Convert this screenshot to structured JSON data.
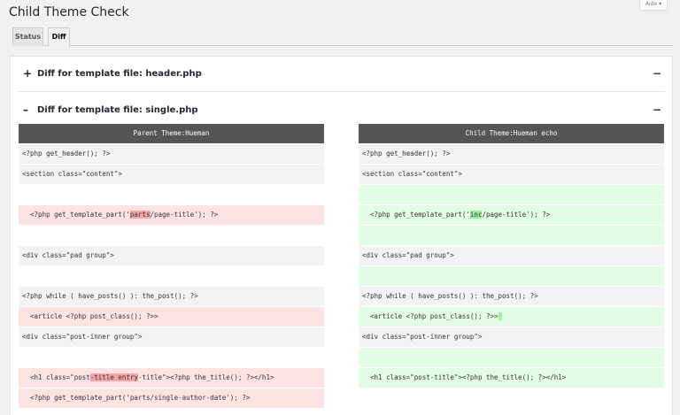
{
  "page": {
    "title": "Child Theme Check",
    "help": "Aide ▾"
  },
  "tabs": [
    {
      "label": "Status",
      "active": false
    },
    {
      "label": "Diff",
      "active": true
    }
  ],
  "accordions": [
    {
      "title": "Diff for template file: header.php",
      "expanded": false,
      "icon": "plus-icon"
    },
    {
      "title": "Diff for template file: single.php",
      "expanded": true,
      "icon": "minus-icon"
    }
  ],
  "diff": {
    "left_header": "Parent Theme:Hueman",
    "right_header": "Child Theme:Hueman echo",
    "left_rows": [
      {
        "type": "same",
        "text": "<?php get_header(); ?>"
      },
      {
        "type": "same",
        "text": "<section class=\"content\">"
      },
      {
        "type": "blank",
        "text": ""
      },
      {
        "type": "del",
        "pre": "<?php get_template_part('",
        "hl": "parts",
        "post": "/page-title'); ?>"
      },
      {
        "type": "blank",
        "text": ""
      },
      {
        "type": "same",
        "text": "<div class=\"pad group\">"
      },
      {
        "type": "blank",
        "text": ""
      },
      {
        "type": "same",
        "text": "<?php while ( have_posts() ): the_post(); ?>"
      },
      {
        "type": "del",
        "text": "<article <?php post_class(); ?>>"
      },
      {
        "type": "same",
        "text": "<div class=\"post-inner group\">"
      },
      {
        "type": "blank",
        "text": ""
      },
      {
        "type": "del",
        "pre": "<h1 class=\"post",
        "hl": "-title entry",
        "post": "-title\"><?php the_title(); ?></h1>"
      },
      {
        "type": "del",
        "text": "<?php get_template_part('parts/single-author-date'); ?>"
      }
    ],
    "right_rows": [
      {
        "type": "same",
        "text": "<?php get_header(); ?>"
      },
      {
        "type": "same",
        "text": "<section class=\"content\">"
      },
      {
        "type": "add",
        "text": ""
      },
      {
        "type": "add",
        "pre": "<?php get_template_part('",
        "hl": "inc",
        "post": "/page-title'); ?>"
      },
      {
        "type": "add",
        "text": ""
      },
      {
        "type": "same",
        "text": "<div class=\"pad group\">"
      },
      {
        "type": "add",
        "text": ""
      },
      {
        "type": "same",
        "text": "<?php while ( have_posts() ): the_post(); ?>"
      },
      {
        "type": "add",
        "pre": "<article <?php post_class(); ?>>",
        "hl": " ",
        "post": ""
      },
      {
        "type": "same",
        "text": "<div class=\"post-inner group\">"
      },
      {
        "type": "add",
        "text": ""
      },
      {
        "type": "add",
        "text": "<h1 class=\"post-title\"><?php the_title(); ?></h1>"
      },
      {
        "type": "blank",
        "text": ""
      }
    ]
  },
  "colors": {
    "header_bg": "#555555",
    "deleted_bg": "#fde4e4",
    "deleted_highlight": "#f6a6a6",
    "added_bg": "#e4fce4",
    "added_highlight": "#9ef09e",
    "unchanged_bg": "#f3f3f3"
  }
}
